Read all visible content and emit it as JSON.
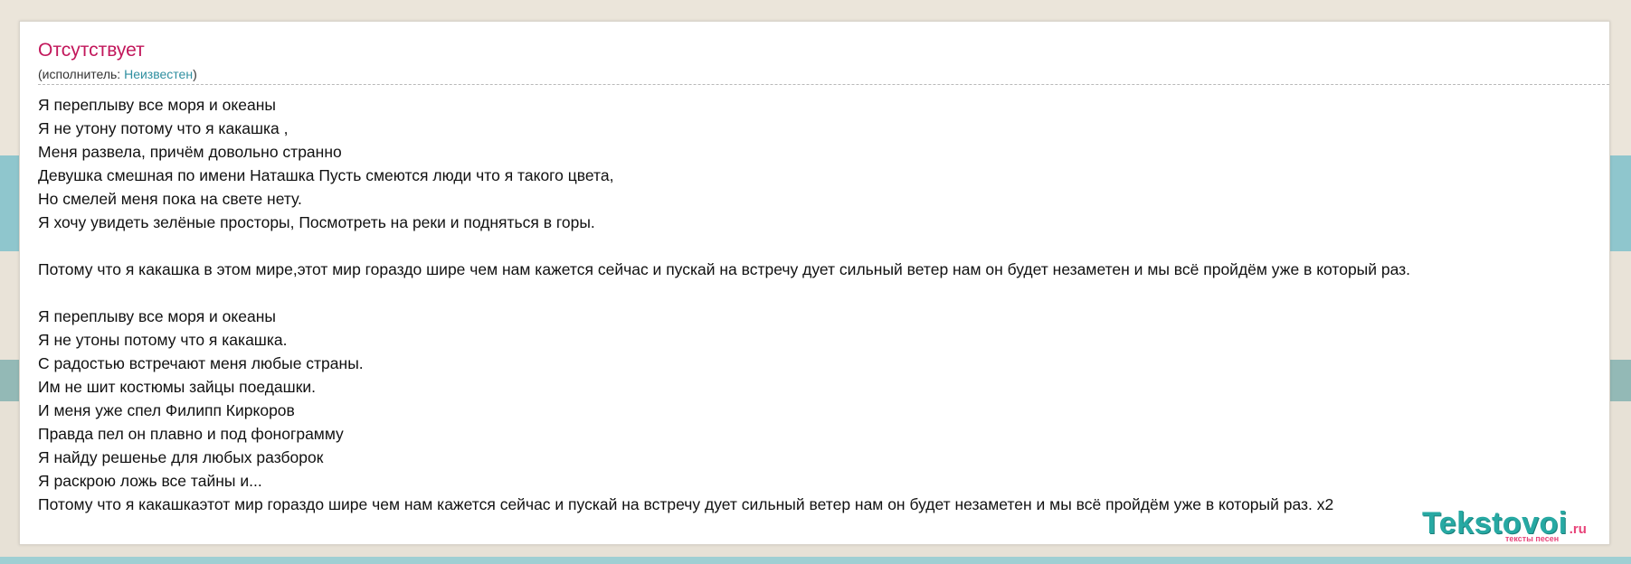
{
  "song": {
    "title": "Отсутствует",
    "artist_prefix": "(исполнитель: ",
    "artist_name": "Неизвестен",
    "artist_suffix": ")"
  },
  "lyrics": [
    "Я переплыву все моря и океаны",
    "Я не утону потому что я какашка ,",
    "Меня развела, причём довольно странно",
    "Девушка смешная по имени Наташка Пусть смеются люди что я такого цвета,",
    "Но смелей меня пока на свете нету.",
    "Я хочу увидеть зелёные просторы, Посмотреть на реки и подняться в горы.",
    "",
    "Потому что я какашка в этом мире,этот мир гораздо шире чем нам кажется сейчас и пускай на встречу дует сильный ветер нам он будет незаметен и мы всё пройдём уже в который раз.",
    "",
    "Я переплыву все моря и океаны",
    "Я не утоны потому что я какашка.",
    "С радостью встречают меня любые страны.",
    "Им не шит костюмы зайцы поедашки.",
    "И меня уже спел Филипп Киркоров",
    "Правда пел он плавно и под фонограмму",
    "Я найду решенье для любых разборок",
    "Я раскрою ложь все тайны и...",
    "Потому что я какашкаэтот мир гораздо шире чем нам кажется сейчас и пускай на встречу дует сильный ветер нам он будет незаметен и мы всё пройдём уже в который раз. x2"
  ],
  "watermark": {
    "main": "Tekstovoi",
    "tld": ".ru",
    "tagline": "тексты песен"
  },
  "colors": {
    "title": "#c2175b",
    "link": "#2f8fa0",
    "logo": "#27a9a3",
    "logo_accent": "#e8457a"
  }
}
